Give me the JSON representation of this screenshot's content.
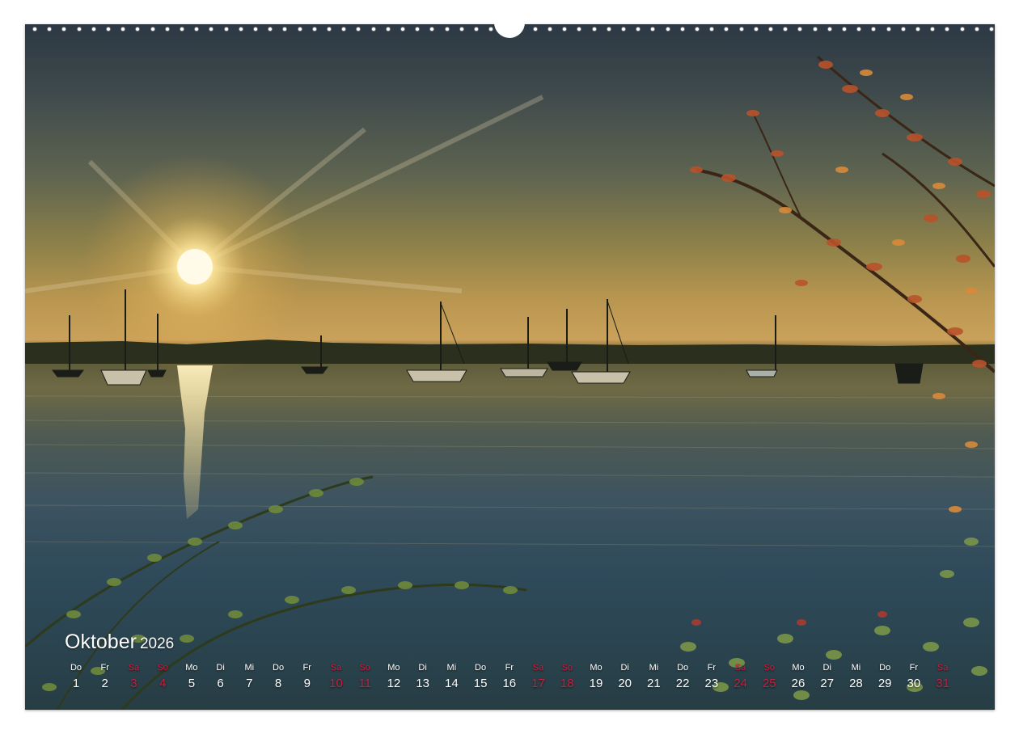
{
  "calendar": {
    "month": "Oktober",
    "year": "2026",
    "days": [
      {
        "wd": "Do",
        "n": "1",
        "we": false
      },
      {
        "wd": "Fr",
        "n": "2",
        "we": false
      },
      {
        "wd": "Sa",
        "n": "3",
        "we": true
      },
      {
        "wd": "So",
        "n": "4",
        "we": true
      },
      {
        "wd": "Mo",
        "n": "5",
        "we": false
      },
      {
        "wd": "Di",
        "n": "6",
        "we": false
      },
      {
        "wd": "Mi",
        "n": "7",
        "we": false
      },
      {
        "wd": "Do",
        "n": "8",
        "we": false
      },
      {
        "wd": "Fr",
        "n": "9",
        "we": false
      },
      {
        "wd": "Sa",
        "n": "10",
        "we": true
      },
      {
        "wd": "So",
        "n": "11",
        "we": true
      },
      {
        "wd": "Mo",
        "n": "12",
        "we": false
      },
      {
        "wd": "Di",
        "n": "13",
        "we": false
      },
      {
        "wd": "Mi",
        "n": "14",
        "we": false
      },
      {
        "wd": "Do",
        "n": "15",
        "we": false
      },
      {
        "wd": "Fr",
        "n": "16",
        "we": false
      },
      {
        "wd": "Sa",
        "n": "17",
        "we": true
      },
      {
        "wd": "So",
        "n": "18",
        "we": true
      },
      {
        "wd": "Mo",
        "n": "19",
        "we": false
      },
      {
        "wd": "Di",
        "n": "20",
        "we": false
      },
      {
        "wd": "Mi",
        "n": "21",
        "we": false
      },
      {
        "wd": "Do",
        "n": "22",
        "we": false
      },
      {
        "wd": "Fr",
        "n": "23",
        "we": false
      },
      {
        "wd": "Sa",
        "n": "24",
        "we": true
      },
      {
        "wd": "So",
        "n": "25",
        "we": true
      },
      {
        "wd": "Mo",
        "n": "26",
        "we": false
      },
      {
        "wd": "Di",
        "n": "27",
        "we": false
      },
      {
        "wd": "Mi",
        "n": "28",
        "we": false
      },
      {
        "wd": "Do",
        "n": "29",
        "we": false
      },
      {
        "wd": "Fr",
        "n": "30",
        "we": false
      },
      {
        "wd": "Sa",
        "n": "31",
        "we": true
      }
    ]
  },
  "colors": {
    "weekday_text": "#ffffff",
    "weekend_text": "#c81e3c",
    "page_background": "#ffffff"
  },
  "photo": {
    "icons": [
      "sun-icon",
      "sailboat-icon",
      "autumn-branch-icon",
      "green-shrub-icon"
    ]
  }
}
